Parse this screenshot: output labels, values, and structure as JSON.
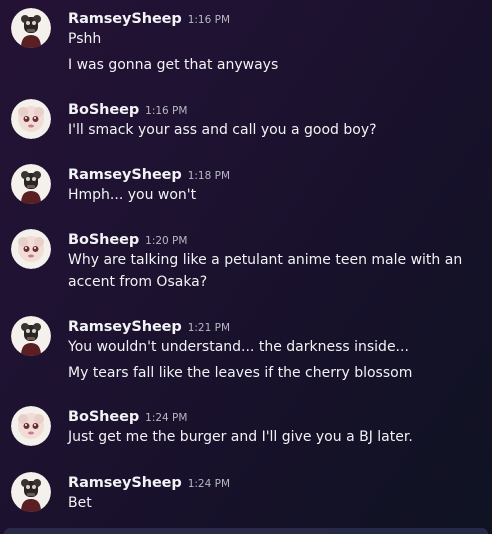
{
  "messages": [
    {
      "author": "RamseySheep",
      "time": "1:16 PM",
      "avatar_icon": "ramsey-avatar",
      "lines": [
        "Pshh",
        "I was gonna get that anyways"
      ]
    },
    {
      "author": "BoSheep",
      "time": "1:16 PM",
      "avatar_icon": "bo-avatar",
      "lines": [
        "I'll smack your ass and call you a good boy?"
      ]
    },
    {
      "author": "RamseySheep",
      "time": "1:18 PM",
      "avatar_icon": "ramsey-avatar",
      "lines": [
        "Hmph... you won't"
      ]
    },
    {
      "author": "BoSheep",
      "time": "1:20 PM",
      "avatar_icon": "bo-avatar",
      "lines": [
        "Why are talking like a petulant anime teen male with an",
        "accent from Osaka?"
      ]
    },
    {
      "author": "RamseySheep",
      "time": "1:21 PM",
      "avatar_icon": "ramsey-avatar",
      "lines": [
        "You wouldn't understand... the darkness inside...",
        "My tears fall like the leaves if the cherry blossom"
      ]
    },
    {
      "author": "BoSheep",
      "time": "1:24 PM",
      "avatar_icon": "bo-avatar",
      "lines": [
        "Just get me the burger and I'll give you a BJ later."
      ]
    },
    {
      "author": "RamseySheep",
      "time": "1:24 PM",
      "avatar_icon": "ramsey-avatar",
      "lines": [
        "Bet"
      ]
    }
  ],
  "colors": {
    "background": "#1e1231",
    "text": "#f2f3f5",
    "timestamp": "#b5bac1"
  }
}
